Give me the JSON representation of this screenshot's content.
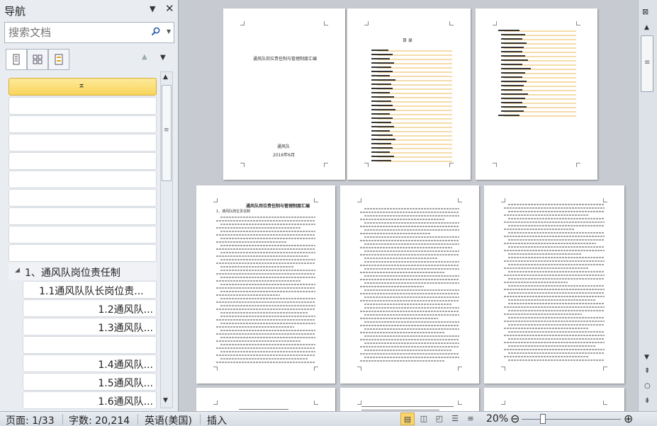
{
  "nav": {
    "title": "导航",
    "search_placeholder": "搜索文档",
    "tabs": [
      "headings-view",
      "pages-view",
      "results-view"
    ],
    "headings": [
      {
        "label": "",
        "selected": true
      },
      {
        "label": ""
      },
      {
        "label": ""
      },
      {
        "label": ""
      },
      {
        "label": ""
      },
      {
        "label": ""
      },
      {
        "label": ""
      },
      {
        "label": ""
      },
      {
        "label": ""
      },
      {
        "label": ""
      },
      {
        "label": "1、通风队岗位责任制",
        "level": 1
      },
      {
        "label": "1.1通风队队长岗位责...",
        "level": 2
      },
      {
        "label": "1.2通风队...",
        "level": 2
      },
      {
        "label": "1.3通风队...",
        "level": 2
      },
      {
        "label": "",
        "level": 2
      },
      {
        "label": "1.4通风队...",
        "level": 2
      },
      {
        "label": "1.5通风队...",
        "level": 2
      },
      {
        "label": "1.6通风队...",
        "level": 2
      }
    ]
  },
  "document": {
    "cover_title": "通风队岗位责任制与管理制度汇编",
    "cover_org": "通风队",
    "cover_date": "2016年6月",
    "toc_title": "目    录",
    "page3_title": "通风队岗位责任制与管理制度汇编",
    "page3_subtitle": "1、通风队岗位责任制"
  },
  "status": {
    "page": "页面: 1/33",
    "words": "字数: 20,214",
    "language": "英语(美国)",
    "mode": "插入",
    "zoom": "20%",
    "zoom_level": 0.2
  }
}
